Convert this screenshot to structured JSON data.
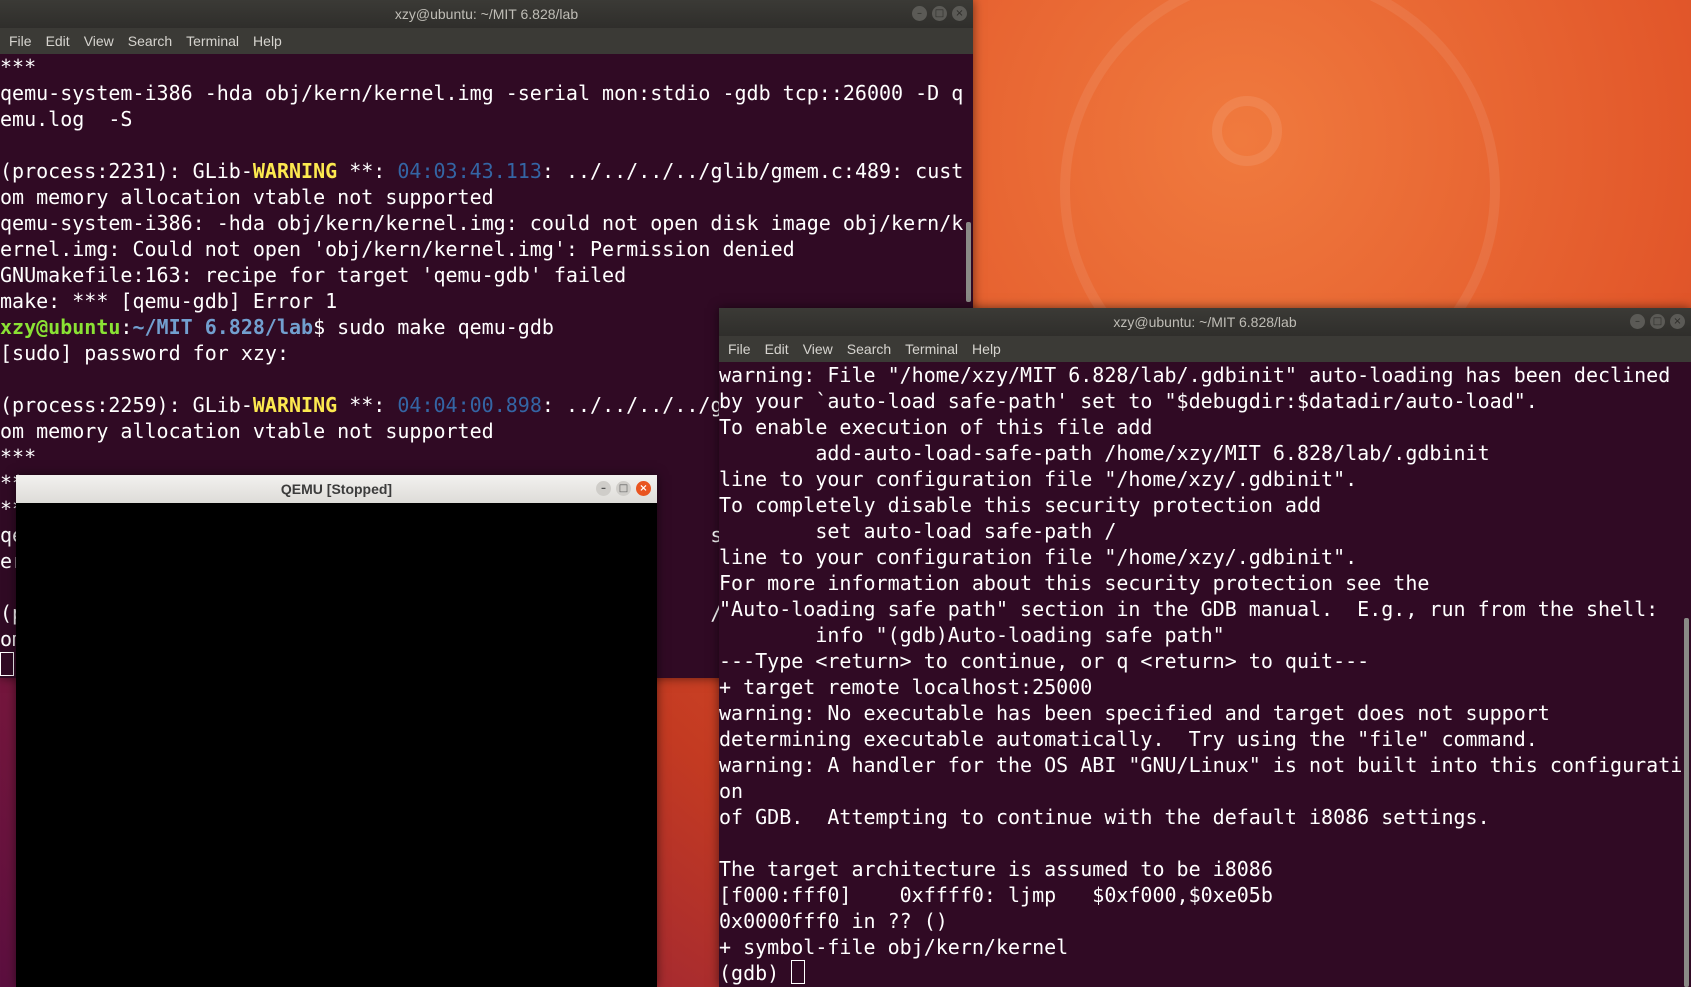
{
  "desktop": {
    "background_colors": [
      "#f07a3e",
      "#c33a22",
      "#5b0f3f"
    ]
  },
  "left_terminal": {
    "title": "xzy@ubuntu: ~/MIT 6.828/lab",
    "menu": [
      "File",
      "Edit",
      "View",
      "Search",
      "Terminal",
      "Help"
    ],
    "lines": [
      {
        "text": "***"
      },
      {
        "text": "qemu-system-i386 -hda obj/kern/kernel.img -serial mon:stdio -gdb tcp::26000 -D q"
      },
      {
        "text": "emu.log  -S"
      },
      {
        "text": ""
      },
      {
        "segments": [
          {
            "t": "(process:2231): GLib-"
          },
          {
            "t": "WARNING",
            "c": "warn"
          },
          {
            "t": " **: "
          },
          {
            "t": "04:03:43.113",
            "c": "time"
          },
          {
            "t": ": ../../../../glib/gmem.c:489: cust"
          }
        ]
      },
      {
        "text": "om memory allocation vtable not supported"
      },
      {
        "text": "qemu-system-i386: -hda obj/kern/kernel.img: could not open disk image obj/kern/k"
      },
      {
        "text": "ernel.img: Could not open 'obj/kern/kernel.img': Permission denied"
      },
      {
        "text": "GNUmakefile:163: recipe for target 'qemu-gdb' failed"
      },
      {
        "text": "make: *** [qemu-gdb] Error 1"
      },
      {
        "segments": [
          {
            "t": "xzy@ubuntu",
            "c": "prompt-user"
          },
          {
            "t": ":"
          },
          {
            "t": "~/MIT 6.828/lab",
            "c": "prompt-path"
          },
          {
            "t": "$ sudo make qemu-gdb"
          }
        ]
      },
      {
        "text": "[sudo] password for xzy:"
      },
      {
        "text": ""
      },
      {
        "segments": [
          {
            "t": "(process:2259): GLib-"
          },
          {
            "t": "WARNING",
            "c": "warn"
          },
          {
            "t": " **: "
          },
          {
            "t": "04:04:00.898",
            "c": "time"
          },
          {
            "t": ": ../../../../g"
          }
        ]
      },
      {
        "text": "om memory allocation vtable not supported"
      },
      {
        "text": "***"
      },
      {
        "text": "**"
      },
      {
        "text": "**"
      },
      {
        "text": "qe                                                         stdio"
      },
      {
        "text": "er"
      },
      {
        "text": ""
      },
      {
        "text": "(p                                                         /../g"
      },
      {
        "text": "om"
      },
      {
        "cursor": true
      }
    ]
  },
  "right_terminal": {
    "title": "xzy@ubuntu: ~/MIT 6.828/lab",
    "menu": [
      "File",
      "Edit",
      "View",
      "Search",
      "Terminal",
      "Help"
    ],
    "lines": [
      {
        "text": "warning: File \"/home/xzy/MIT 6.828/lab/.gdbinit\" auto-loading has been declined"
      },
      {
        "text": "by your `auto-load safe-path' set to \"$debugdir:$datadir/auto-load\"."
      },
      {
        "text": "To enable execution of this file add"
      },
      {
        "text": "        add-auto-load-safe-path /home/xzy/MIT 6.828/lab/.gdbinit"
      },
      {
        "text": "line to your configuration file \"/home/xzy/.gdbinit\"."
      },
      {
        "text": "To completely disable this security protection add"
      },
      {
        "text": "        set auto-load safe-path /"
      },
      {
        "text": "line to your configuration file \"/home/xzy/.gdbinit\"."
      },
      {
        "text": "For more information about this security protection see the"
      },
      {
        "text": "\"Auto-loading safe path\" section in the GDB manual.  E.g., run from the shell:"
      },
      {
        "text": "        info \"(gdb)Auto-loading safe path\""
      },
      {
        "text": "---Type <return> to continue, or q <return> to quit---"
      },
      {
        "text": "+ target remote localhost:25000"
      },
      {
        "text": "warning: No executable has been specified and target does not support"
      },
      {
        "text": "determining executable automatically.  Try using the \"file\" command."
      },
      {
        "text": "warning: A handler for the OS ABI \"GNU/Linux\" is not built into this configurati"
      },
      {
        "text": "on"
      },
      {
        "text": "of GDB.  Attempting to continue with the default i8086 settings."
      },
      {
        "text": ""
      },
      {
        "text": "The target architecture is assumed to be i8086"
      },
      {
        "text": "[f000:fff0]    0xffff0: ljmp   $0xf000,$0xe05b"
      },
      {
        "text": "0x0000fff0 in ?? ()"
      },
      {
        "text": "+ symbol-file obj/kern/kernel"
      },
      {
        "text": "(gdb) ",
        "cursor": true
      }
    ]
  },
  "qemu_window": {
    "title": "QEMU [Stopped]"
  }
}
